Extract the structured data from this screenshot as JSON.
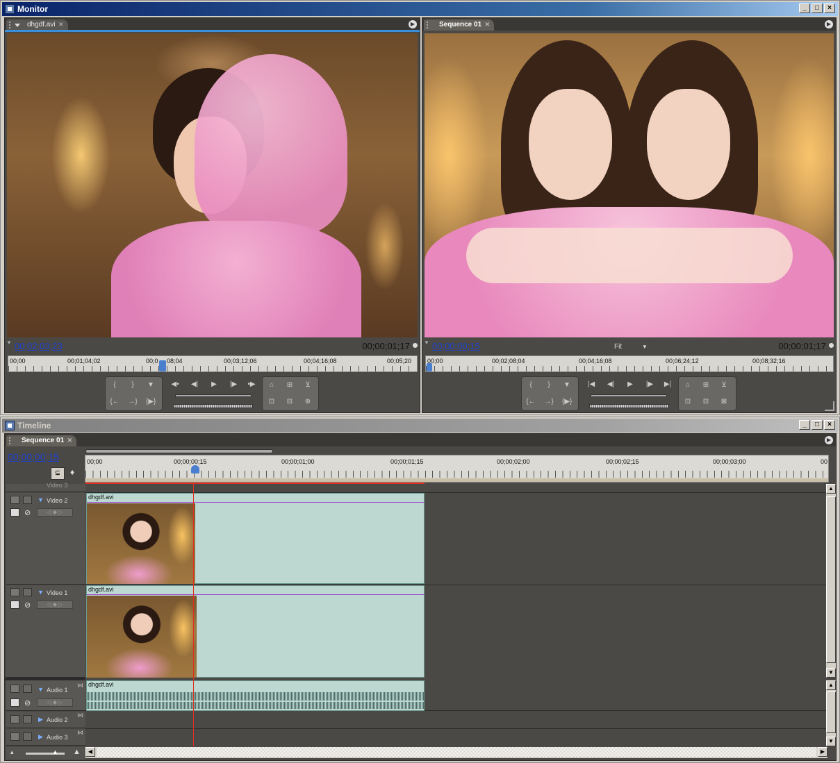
{
  "monitor": {
    "title": "Monitor",
    "source": {
      "tab_label": "dhgdf.avi",
      "timecode": "00;02;03;23",
      "duration": "00;00;01;17",
      "ruler_labels": [
        "00;00",
        "00;01;04;02",
        "00;0",
        "08;04",
        "00;03;12;06",
        "00;04;16;08",
        "00;05;20"
      ]
    },
    "program": {
      "tab_label": "Sequence 01",
      "timecode": "00;00;00;15",
      "fit_label": "Fit",
      "duration": "00;00;01;17",
      "ruler_labels": [
        "00;00",
        "00;02;08;04",
        "00;04;16;08",
        "00;06;24;12",
        "00;08;32;16"
      ]
    }
  },
  "timeline": {
    "title": "Timeline",
    "tab_label": "Sequence 01",
    "timecode": "00;00;00;15",
    "ruler_labels": [
      "00;00",
      "00;00;00;15",
      "00;00;01;00",
      "00;00;01;15",
      "00;00;02;00",
      "00;00;02;15",
      "00;00;03;00",
      "00"
    ],
    "tracks": {
      "video3": "Video 3",
      "video2": "Video 2",
      "video1": "Video 1",
      "audio1": "Audio 1",
      "audio2": "Audio 2",
      "audio3": "Audio 3"
    },
    "clips": {
      "v2": "dhgdf.avi",
      "v1": "dhgdf.avi",
      "a1": "dhgdf.avi"
    }
  },
  "window_buttons": {
    "minimize": "_",
    "maximize": "□",
    "close": "×"
  },
  "colors": {
    "accent": "#1a3fd0",
    "playhead": "#e03020",
    "clip": "#bcd8d0",
    "panel": "#4b4945"
  }
}
